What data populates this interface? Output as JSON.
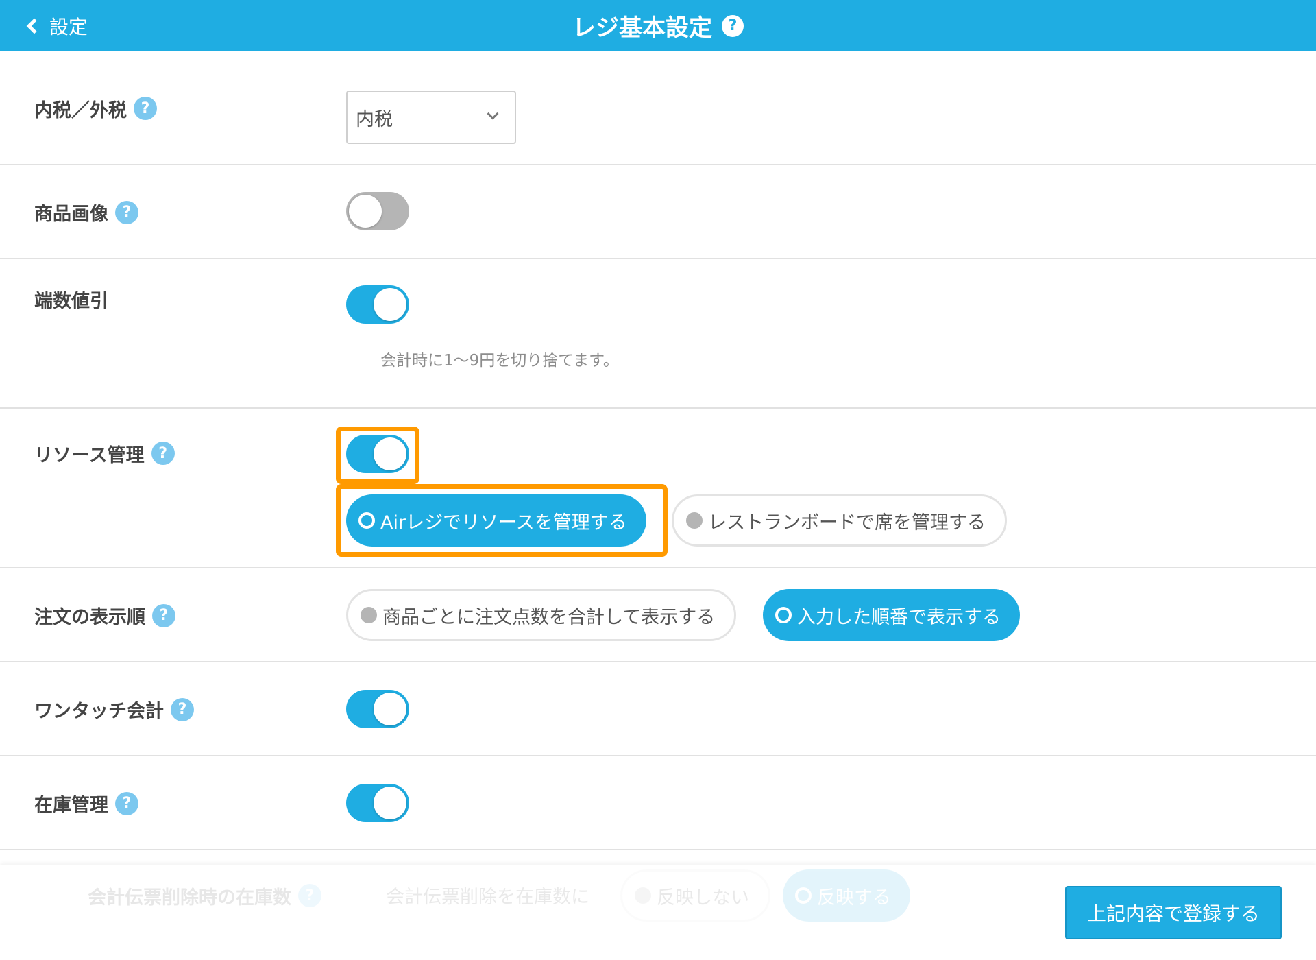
{
  "header": {
    "back_label": "設定",
    "title": "レジ基本設定",
    "help_icon": "?"
  },
  "settings": {
    "tax": {
      "label": "内税／外税",
      "help": "?",
      "selected": "内税"
    },
    "product_image": {
      "label": "商品画像",
      "help": "?",
      "enabled": false
    },
    "rounding": {
      "label": "端数値引",
      "enabled": true,
      "note": "会計時に1〜9円を切り捨てます。"
    },
    "resource": {
      "label": "リソース管理",
      "help": "?",
      "enabled": true,
      "options": [
        "Airレジでリソースを管理する",
        "レストランボードで席を管理する"
      ],
      "selected_index": 0
    },
    "order_display": {
      "label": "注文の表示順",
      "help": "?",
      "options": [
        "商品ごとに注文点数を合計して表示する",
        "入力した順番で表示する"
      ],
      "selected_index": 1
    },
    "one_touch": {
      "label": "ワンタッチ会計",
      "help": "?",
      "enabled": true
    },
    "inventory": {
      "label": "在庫管理",
      "help": "?",
      "enabled": true
    },
    "slip_delete": {
      "label": "会計伝票削除時の在庫数",
      "help": "?",
      "desc": "会計伝票削除を在庫数に",
      "options": [
        "反映しない",
        "反映する"
      ],
      "selected_index": 1
    }
  },
  "footer": {
    "submit_label": "上記内容で登録する"
  },
  "colors": {
    "primary": "#1fade2",
    "highlight": "#ff9a00",
    "help": "#7cc8ef",
    "toggle_off": "#b5b5b5"
  }
}
